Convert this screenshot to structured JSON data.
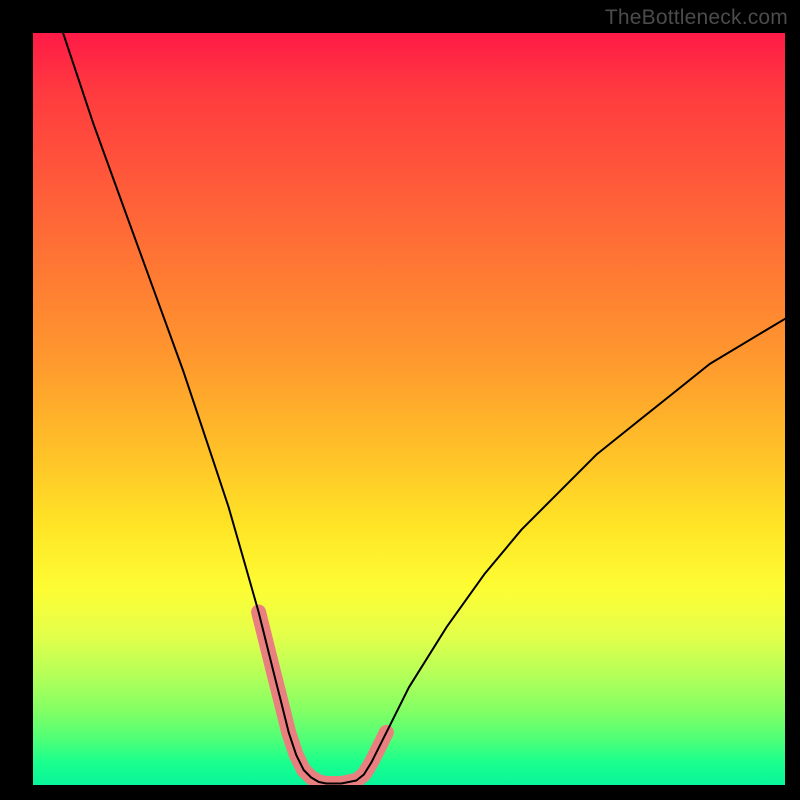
{
  "watermark": "TheBottleneck.com",
  "chart_data": {
    "type": "line",
    "title": "",
    "xlabel": "",
    "ylabel": "",
    "x_range": [
      0,
      100
    ],
    "y_range": [
      0,
      100
    ],
    "grid": false,
    "legend": false,
    "background_gradient": {
      "direction": "top-to-bottom",
      "stops": [
        {
          "pos": 0,
          "color": "#ff1a46"
        },
        {
          "pos": 20,
          "color": "#ff5a3a"
        },
        {
          "pos": 44,
          "color": "#ff9a2e"
        },
        {
          "pos": 66,
          "color": "#ffe626"
        },
        {
          "pos": 80,
          "color": "#e4ff4a"
        },
        {
          "pos": 94,
          "color": "#4dff77"
        },
        {
          "pos": 100,
          "color": "#08f59a"
        }
      ]
    },
    "series": [
      {
        "name": "black-curve",
        "stroke": "#000000",
        "stroke_width": 2,
        "x": [
          4,
          8,
          12,
          16,
          20,
          24,
          26,
          28,
          30,
          32,
          33,
          34,
          35,
          36,
          37,
          38,
          39,
          41,
          43,
          44,
          45,
          47,
          50,
          55,
          60,
          65,
          70,
          75,
          80,
          85,
          90,
          95,
          100
        ],
        "y": [
          100,
          88,
          77,
          66,
          55,
          43,
          37,
          30,
          23,
          15,
          11,
          7,
          4,
          2,
          1,
          0.4,
          0.2,
          0.2,
          0.6,
          1.4,
          3,
          7,
          13,
          21,
          28,
          34,
          39,
          44,
          48,
          52,
          56,
          59,
          62
        ]
      },
      {
        "name": "pink-highlight",
        "stroke": "#ea7f80",
        "stroke_width": 15,
        "stroke_linecap": "round",
        "x": [
          30,
          32,
          33,
          34,
          35,
          36,
          37,
          38,
          39,
          41,
          43,
          44,
          45,
          47
        ],
        "y": [
          23,
          15,
          11,
          7,
          4,
          2,
          1,
          0.4,
          0.2,
          0.2,
          0.6,
          1.4,
          3,
          7
        ]
      }
    ]
  }
}
